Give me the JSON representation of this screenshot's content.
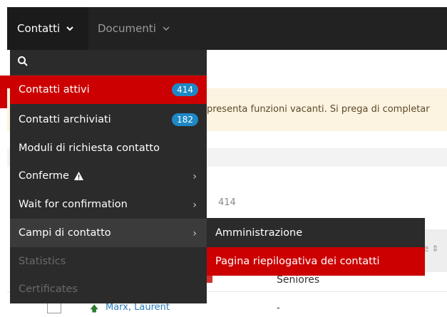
{
  "navbar": {
    "items": [
      {
        "label": "Contatti"
      },
      {
        "label": "Documenti"
      }
    ]
  },
  "dropdown": {
    "items": [
      {
        "label": "Contatti attivi",
        "badge": "414"
      },
      {
        "label": "Contatti archiviati",
        "badge": "182"
      },
      {
        "label": "Moduli di richiesta contatto"
      },
      {
        "label": "Conferme"
      },
      {
        "label": "Wait for confirmation"
      },
      {
        "label": "Campi di contatto"
      },
      {
        "label": "Statistics"
      },
      {
        "label": "Certificates"
      }
    ]
  },
  "submenu": {
    "items": [
      {
        "label": "Amministrazione"
      },
      {
        "label": "Pagina riepilogativa dei contatti"
      }
    ]
  },
  "background": {
    "notice_text": "presenta funzioni vacanti. Si prega di completar",
    "count": "414",
    "table": {
      "row1": {
        "group": "Seniores"
      },
      "row2": {
        "name": "Marx, Laurent",
        "group": "-"
      }
    }
  },
  "colors": {
    "accent_red": "#cc0000",
    "badge_blue": "#1e88c7",
    "menu_bg": "#2b2b2b",
    "navbar_bg": "#222222",
    "notice_bg": "#fcf3e0"
  },
  "icons": [
    "search-icon",
    "chevron-down-icon",
    "chevron-right-icon",
    "warning-icon",
    "arrow-up-icon"
  ]
}
